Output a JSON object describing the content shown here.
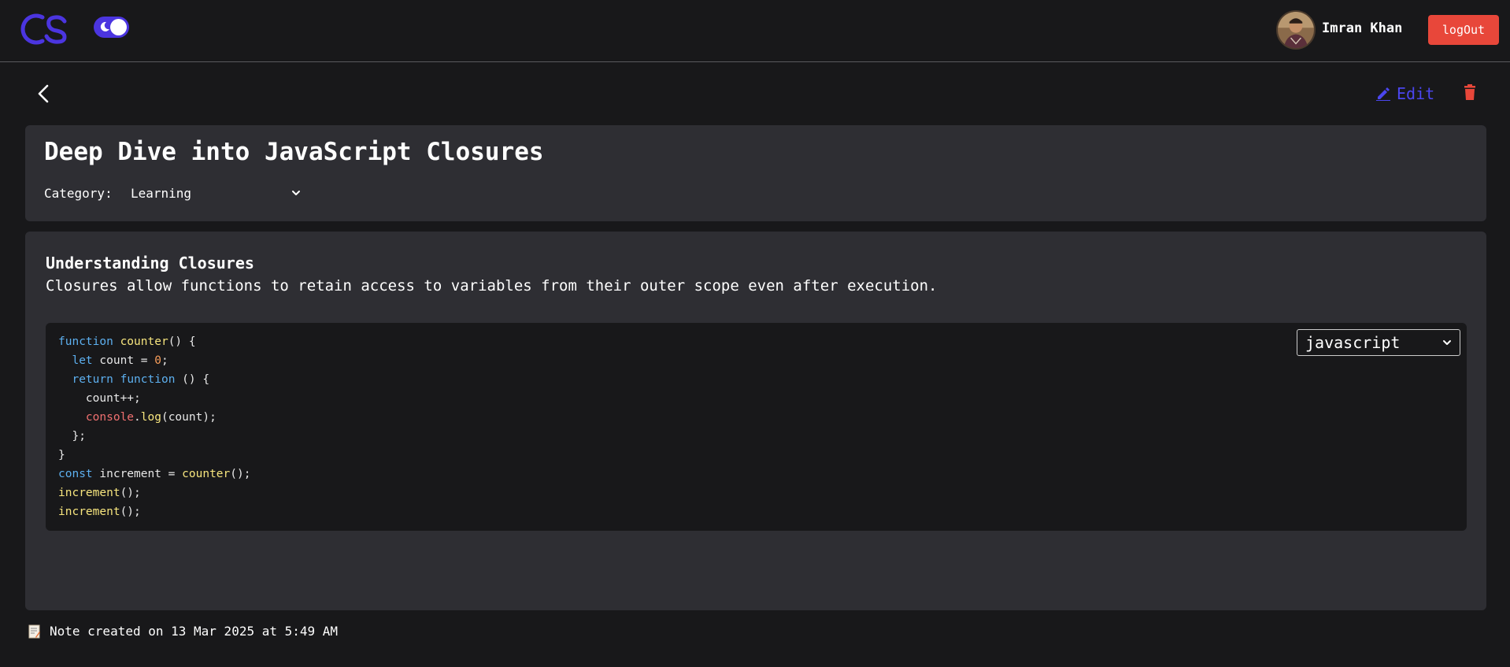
{
  "header": {
    "logo_text": "CS",
    "username": "Imran Khan",
    "logout_label": "logOut",
    "accent_color": "#4b35e0",
    "logout_color": "#e8473a"
  },
  "actions": {
    "edit_label": "Edit"
  },
  "note": {
    "title": "Deep Dive into JavaScript Closures",
    "category_label": "Category:",
    "category_value": "Learning",
    "section_heading": "Understanding Closures",
    "section_body": "Closures allow functions to retain access to variables from their outer scope even after execution.",
    "code_language": "javascript",
    "code_lines": [
      [
        {
          "t": "function",
          "c": "kw"
        },
        {
          "t": " "
        },
        {
          "t": "counter",
          "c": "fn"
        },
        {
          "t": "() {"
        }
      ],
      [
        {
          "t": "  "
        },
        {
          "t": "let",
          "c": "kw"
        },
        {
          "t": " count = "
        },
        {
          "t": "0",
          "c": "num"
        },
        {
          "t": ";"
        }
      ],
      [
        {
          "t": "  "
        },
        {
          "t": "return",
          "c": "kw"
        },
        {
          "t": " "
        },
        {
          "t": "function",
          "c": "kw"
        },
        {
          "t": " () {"
        }
      ],
      [
        {
          "t": "    count++;"
        }
      ],
      [
        {
          "t": "    "
        },
        {
          "t": "console",
          "c": "obj"
        },
        {
          "t": "."
        },
        {
          "t": "log",
          "c": "fn"
        },
        {
          "t": "(count);"
        }
      ],
      [
        {
          "t": "  };"
        }
      ],
      [
        {
          "t": "}"
        }
      ],
      [
        {
          "t": "const",
          "c": "kw"
        },
        {
          "t": " increment = "
        },
        {
          "t": "counter",
          "c": "fn"
        },
        {
          "t": "();"
        }
      ],
      [
        {
          "t": "increment",
          "c": "fn"
        },
        {
          "t": "();"
        }
      ],
      [
        {
          "t": "increment",
          "c": "fn"
        },
        {
          "t": "();"
        }
      ]
    ]
  },
  "footer": {
    "created_text": "Note created on 13 Mar 2025 at 5:49 AM"
  }
}
